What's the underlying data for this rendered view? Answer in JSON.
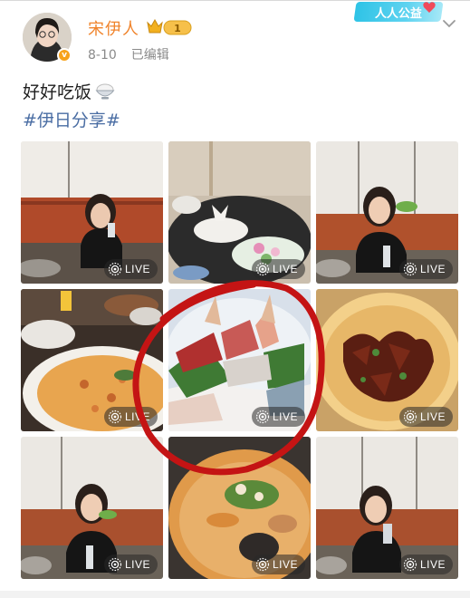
{
  "user": {
    "name": "宋伊人",
    "vip_level": "1",
    "verified_mark": "v"
  },
  "post": {
    "date": "8-10",
    "edited": "已编辑",
    "text": "好好吃饭",
    "hashtag": "#伊日分享#"
  },
  "charity_badge": {
    "label": "人人公益"
  },
  "live_badge": "LIVE",
  "images": [
    {
      "subject": "woman-eating-restaurant",
      "live": true
    },
    {
      "subject": "rabbit-dessert-and-plate",
      "live": true
    },
    {
      "subject": "woman-with-lettuce-wrap",
      "live": true
    },
    {
      "subject": "pizza-and-drinks",
      "live": true
    },
    {
      "subject": "sashimi-platter",
      "live": true
    },
    {
      "subject": "braised-duck-tongues",
      "live": true
    },
    {
      "subject": "woman-holding-food",
      "live": true
    },
    {
      "subject": "ramen-bowl",
      "live": true
    },
    {
      "subject": "woman-drinking-can",
      "live": true
    }
  ],
  "colors": {
    "name": "#f0842c",
    "hashtag": "#4a6da3",
    "meta": "#8a8a8a",
    "annotation": "#c41414"
  }
}
